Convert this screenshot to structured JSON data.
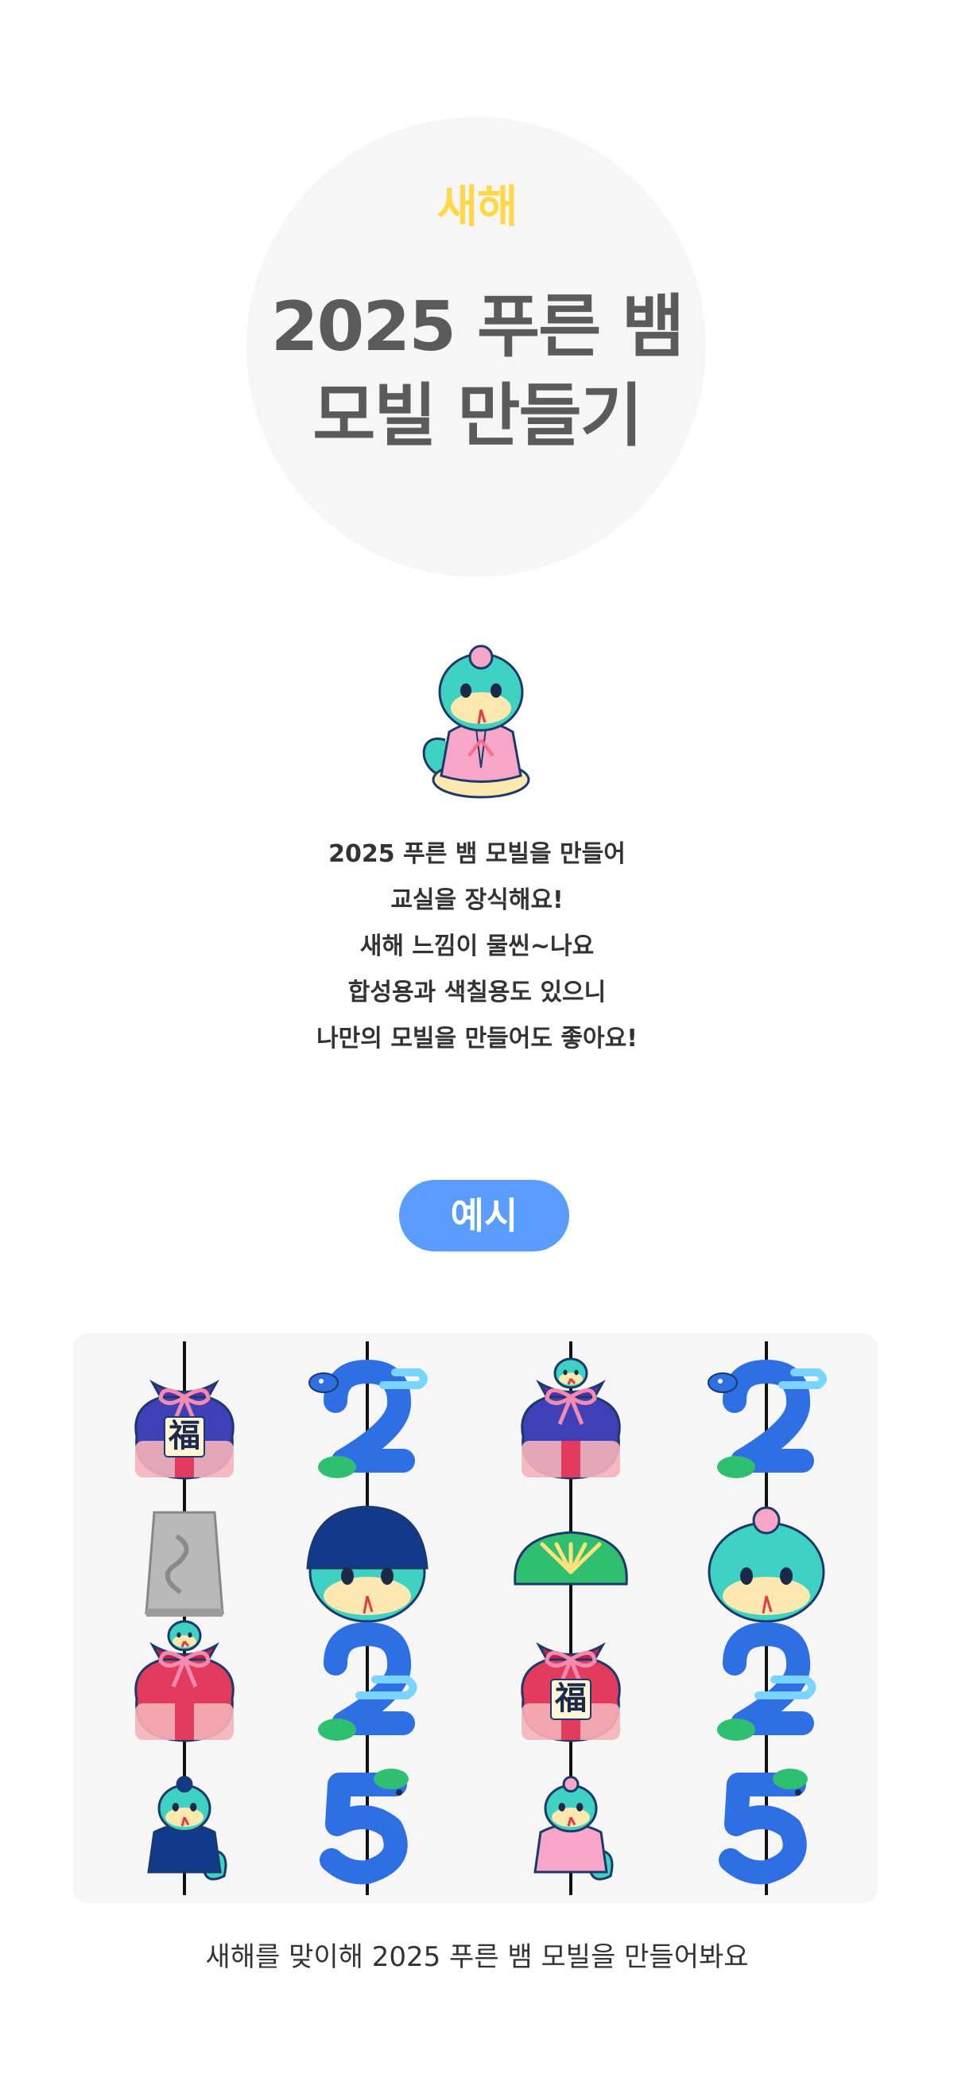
{
  "hero": {
    "kicker": "새해",
    "title_line1": "2025 푸른 뱀",
    "title_line2": "모빌 만들기"
  },
  "intro": {
    "lines": [
      "2025 푸른 뱀 모빌을 만들어",
      "교실을 장식해요!",
      "새해 느낌이 물씬~나요",
      "합성용과 색칠용도 있으니",
      "나만의 모빌을 만들어도 좋아요!"
    ]
  },
  "example_badge": "예시",
  "mobile": {
    "charm_labels": {
      "fortune": "福"
    },
    "columns": [
      [
        "fortune-pouch-purple",
        "bronze-bell",
        "pouch-red-snake",
        "snake-navy-hanbok"
      ],
      [
        "number-2-snake",
        "snake-face-navy-hat",
        "number-2-cloud",
        "number-5-pine"
      ],
      [
        "pouch-purple-snake",
        "pine-tree",
        "fortune-pouch-red",
        "snake-pink-hanbok"
      ],
      [
        "number-2-snake",
        "snake-face-teal",
        "number-2-cloud",
        "number-5-pine"
      ]
    ]
  },
  "colors": {
    "kicker": "#ffd84a",
    "title": "#5b5b5b",
    "badge": "#5b9cff",
    "panel_bg": "#f6f6f6",
    "number_blue": "#2f6fe4",
    "snake_teal": "#3fd1c1"
  },
  "caption": "새해를 맞이해 2025 푸른 뱀 모빌을 만들어봐요"
}
